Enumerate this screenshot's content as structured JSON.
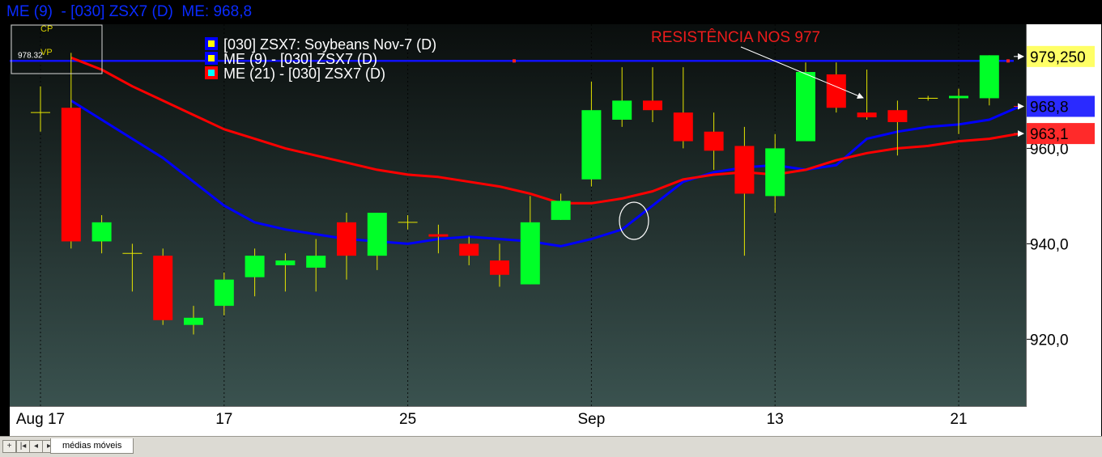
{
  "header": {
    "title": "ME (9)  - [030] ZSX7 (D)  ME: 968,8"
  },
  "legend_box": {
    "cp": "CP",
    "vp": "VP"
  },
  "tabbar": {
    "tab_label": "médias móveis",
    "btn_add": "+",
    "btn_first": "|◂",
    "btn_prev": "◂",
    "btn_next": "▸"
  },
  "chart_data": {
    "type": "candlestick",
    "title": "[030] ZSX7: Soybeans Nov-7",
    "legend": [
      {
        "label": "[030] ZSX7: Soybeans Nov-7     (D)",
        "color": "#ffff00"
      },
      {
        "label": "ME (9)  - [030] ZSX7 (D)",
        "color": "#0000ff"
      },
      {
        "label": "ME (21)  - [030] ZSX7 (D)",
        "color": "#00ffff"
      }
    ],
    "annotation": "RESISTÊNCIA NOS 977",
    "resistance": {
      "value": 978.32,
      "label": "978.32"
    },
    "y_ticks": [
      920,
      940,
      960
    ],
    "y_tick_labels": [
      "920,0",
      "940,0",
      "960,0"
    ],
    "ylim": [
      906,
      986
    ],
    "x_tick_labels": [
      {
        "label": "Aug 17",
        "index": 0
      },
      {
        "label": "17",
        "index": 6
      },
      {
        "label": "25",
        "index": 12
      },
      {
        "label": "Sep",
        "index": 18
      },
      {
        "label": "13",
        "index": 24
      },
      {
        "label": "21",
        "index": 30
      }
    ],
    "price_labels": [
      {
        "text": "979,250",
        "value": 979.25,
        "bg": "#ffff66"
      },
      {
        "text": "968,8",
        "value": 968.8,
        "bg": "#2a2aff"
      },
      {
        "text": "963,1",
        "value": 963.1,
        "bg": "#ff2a2a"
      }
    ],
    "candles": [
      {
        "o": 967.5,
        "h": 973,
        "l": 963.5,
        "c": 967.5
      },
      {
        "o": 968.5,
        "h": 980,
        "l": 939,
        "c": 940.5
      },
      {
        "o": 940.5,
        "h": 946,
        "l": 938,
        "c": 944.5
      },
      {
        "o": 938,
        "h": 940,
        "l": 930,
        "c": 938
      },
      {
        "o": 937.5,
        "h": 939,
        "l": 923,
        "c": 924
      },
      {
        "o": 923,
        "h": 927,
        "l": 921,
        "c": 924.5
      },
      {
        "o": 927,
        "h": 934,
        "l": 925,
        "c": 932.5
      },
      {
        "o": 933,
        "h": 939,
        "l": 929,
        "c": 937.5
      },
      {
        "o": 935.5,
        "h": 938,
        "l": 930,
        "c": 936.5
      },
      {
        "o": 935,
        "h": 941,
        "l": 930,
        "c": 937.5
      },
      {
        "o": 944.5,
        "h": 946.5,
        "l": 932.5,
        "c": 937.5
      },
      {
        "o": 937.5,
        "h": 946.5,
        "l": 934.5,
        "c": 946.5
      },
      {
        "o": 944.5,
        "h": 946,
        "l": 943,
        "c": 944.5
      },
      {
        "o": 942,
        "h": 944,
        "l": 938,
        "c": 941.5
      },
      {
        "o": 940,
        "h": 941.5,
        "l": 935.5,
        "c": 937.5
      },
      {
        "o": 936.5,
        "h": 940,
        "l": 931,
        "c": 933.5
      },
      {
        "o": 931.5,
        "h": 950,
        "l": 931.5,
        "c": 944.5
      },
      {
        "o": 945,
        "h": 950.5,
        "l": 945,
        "c": 949
      },
      {
        "o": 953.5,
        "h": 974,
        "l": 952,
        "c": 968
      },
      {
        "o": 966,
        "h": 977,
        "l": 964.5,
        "c": 970
      },
      {
        "o": 970,
        "h": 977,
        "l": 965.5,
        "c": 968
      },
      {
        "o": 967.5,
        "h": 977,
        "l": 960,
        "c": 961.5
      },
      {
        "o": 963.5,
        "h": 967.5,
        "l": 955.5,
        "c": 959.5
      },
      {
        "o": 960.5,
        "h": 964.5,
        "l": 937.5,
        "c": 950.5
      },
      {
        "o": 950,
        "h": 963,
        "l": 946.5,
        "c": 960
      },
      {
        "o": 961.5,
        "h": 978,
        "l": 961.5,
        "c": 976
      },
      {
        "o": 975.5,
        "h": 978,
        "l": 967.5,
        "c": 968.5
      },
      {
        "o": 967.5,
        "h": 976.5,
        "l": 966,
        "c": 966.5
      },
      {
        "o": 968,
        "h": 970,
        "l": 958.5,
        "c": 965.5
      },
      {
        "o": 970.5,
        "h": 971,
        "l": 970,
        "c": 970.5
      },
      {
        "o": 970.5,
        "h": 972.5,
        "l": 963,
        "c": 971
      },
      {
        "o": 970.5,
        "h": 979.5,
        "l": 969,
        "c": 979.5
      }
    ],
    "series": [
      {
        "name": "ME (9)",
        "color": "#0000ff",
        "start_index": 1,
        "values": [
          970,
          966,
          962,
          958,
          953,
          948,
          944.5,
          943,
          942,
          941,
          940.5,
          940,
          941,
          941.5,
          941,
          940.5,
          939.5,
          941,
          943,
          948,
          953,
          955,
          956,
          956.5,
          955.5,
          956.5,
          962,
          963.5,
          964.5,
          965,
          966,
          968.8
        ]
      },
      {
        "name": "ME (21)",
        "color": "#ff0000",
        "start_index": 1,
        "values": [
          979,
          976.5,
          973,
          970,
          967,
          964,
          962,
          960,
          958.5,
          957,
          955.5,
          954.5,
          954,
          953,
          952,
          950.5,
          948.5,
          948.5,
          949.5,
          951,
          953.5,
          954.5,
          955,
          954.5,
          955.5,
          957.5,
          959,
          960,
          960.5,
          961.5,
          962,
          963.1
        ]
      }
    ]
  }
}
